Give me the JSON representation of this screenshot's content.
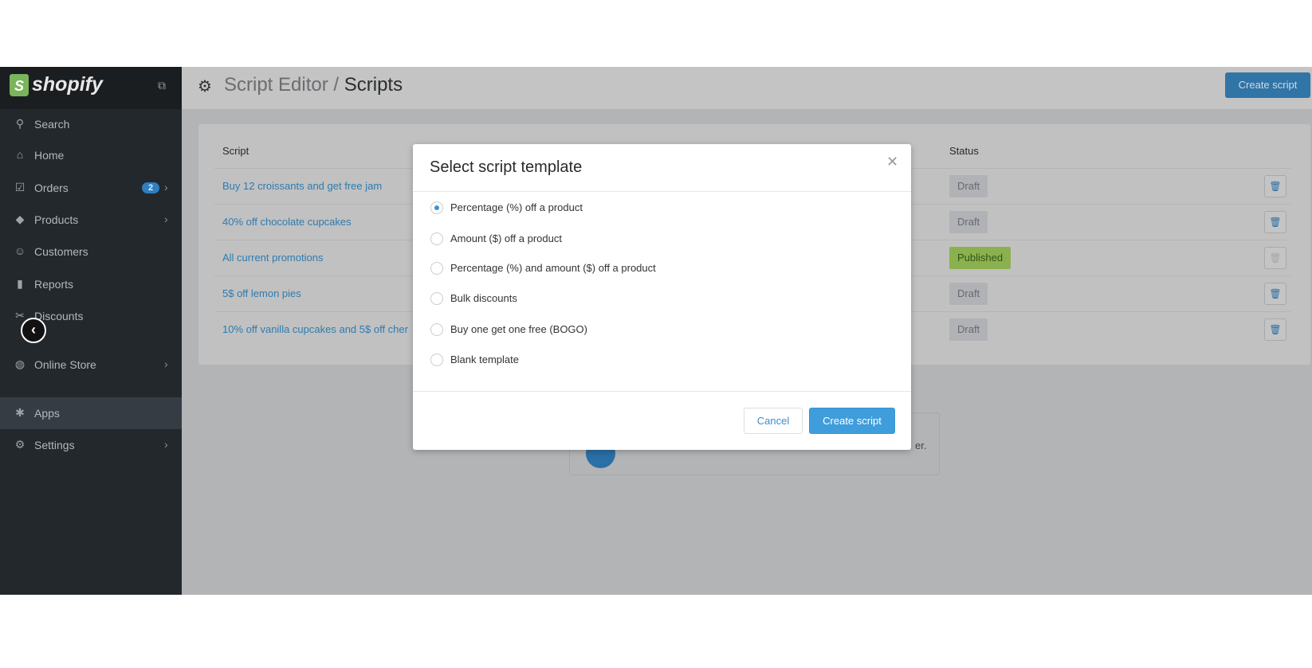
{
  "sidebar": {
    "brand": "shopify",
    "items": [
      {
        "label": "Search",
        "icon": "search-icon",
        "glyph": "⚲"
      },
      {
        "label": "Home",
        "icon": "home-icon",
        "glyph": "⌂"
      },
      {
        "label": "Orders",
        "icon": "orders-icon",
        "glyph": "☑",
        "badge": "2",
        "chevron": true
      },
      {
        "label": "Products",
        "icon": "tag-icon",
        "glyph": "◆",
        "chevron": true
      },
      {
        "label": "Customers",
        "icon": "customers-icon",
        "glyph": "☺"
      },
      {
        "label": "Reports",
        "icon": "bar-chart-icon",
        "glyph": "▮"
      },
      {
        "label": "Discounts",
        "icon": "scissors-icon",
        "glyph": "✂"
      },
      {
        "label": "Online Store",
        "icon": "globe-icon",
        "glyph": "◍",
        "chevron": true
      },
      {
        "label": "Apps",
        "icon": "puzzle-icon",
        "glyph": "✱",
        "active": true
      },
      {
        "label": "Settings",
        "icon": "gear-icon",
        "glyph": "⚙",
        "chevron": true
      }
    ]
  },
  "header": {
    "breadcrumb_parent": "Script Editor",
    "separator": " / ",
    "title": "Scripts",
    "create_label": "Create script"
  },
  "table": {
    "columns": [
      "Script",
      "Status"
    ],
    "rows": [
      {
        "name": "Buy 12 croissants and get free jam",
        "status": "Draft"
      },
      {
        "name": "40% off chocolate cupcakes",
        "status": "Draft"
      },
      {
        "name": "All current promotions",
        "status": "Published"
      },
      {
        "name": "5$ off lemon pies",
        "status": "Draft"
      },
      {
        "name": "10% off vanilla cupcakes and 5$ off cher",
        "status": "Draft"
      }
    ]
  },
  "info": {
    "text_fragment": "er."
  },
  "modal": {
    "title": "Select script template",
    "options": [
      "Percentage (%) off a product",
      "Amount ($) off a product",
      "Percentage (%) and amount ($) off a product",
      "Bulk discounts",
      "Buy one get one free (BOGO)",
      "Blank template"
    ],
    "selected_index": 0,
    "cancel_label": "Cancel",
    "create_label": "Create script"
  },
  "colors": {
    "accent": "#3f9ddb",
    "published": "#8bb14e",
    "sidebar": "#23282d"
  }
}
